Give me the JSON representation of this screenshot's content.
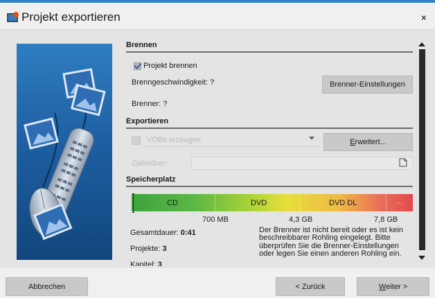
{
  "window": {
    "title": "Projekt exportieren",
    "close_glyph": "×",
    "accent_color": "#2e84c6"
  },
  "sections": {
    "burn": "Brennen",
    "export": "Exportieren",
    "storage": "Speicherplatz"
  },
  "burn": {
    "checkbox_label": "Projekt brennen",
    "checkbox_checked": true,
    "speed_label": "Brenngeschwindigkeit: ?",
    "burner_label": "Brenner: ?",
    "settings_button": "Brenner-Einstellungen"
  },
  "export": {
    "vob_label": "VOBs erzeugen",
    "vob_checked": false,
    "advanced_button_prefix": "E",
    "advanced_button_rest": "rweitert...",
    "target_folder_label": "Zielordner:",
    "target_folder_value": ""
  },
  "storage": {
    "segments": [
      "CD",
      "DVD",
      "DVD DL",
      "..."
    ],
    "sizes": [
      "700 MB",
      "4,3 GB",
      "7,8 GB"
    ],
    "duration_label": "Gesamtdauer:",
    "duration_value": "0:41",
    "projects_label": "Projekte:",
    "projects_value": "3",
    "chapters_label": "Kapitel:",
    "chapters_value": "3",
    "message": "Der Brenner ist nicht bereit oder es ist kein beschreibbarer Rohling eingelegt. Bitte überprüfen Sie die Brenner-Einstellungen oder legen Sie einen anderen Rohling ein."
  },
  "footer": {
    "cancel": "Abbrechen",
    "back": "< Zurück",
    "next_prefix": "W",
    "next_rest": "eiter >"
  },
  "icons": {
    "app": "app-icon",
    "close": "close-icon",
    "folder": "folder-icon",
    "scroll_up": "scroll-up-icon",
    "scroll_down": "scroll-down-icon",
    "dropdown": "chevron-down-icon"
  }
}
